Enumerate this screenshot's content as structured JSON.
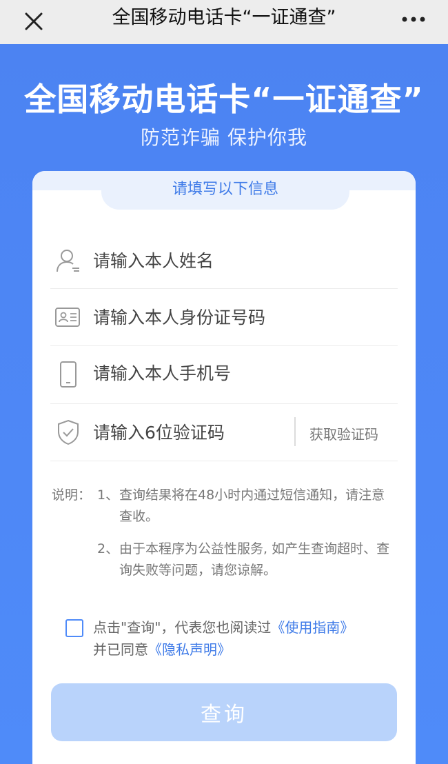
{
  "nav": {
    "title": "全国移动电话卡“一证通查”",
    "close_icon": "close-icon",
    "more_icon": "more-icon"
  },
  "hero": {
    "title": "全国移动电话卡“一证通查”",
    "subtitle": "防范诈骗 保护你我"
  },
  "form": {
    "tab_label": "请填写以下信息",
    "name_placeholder": "请输入本人姓名",
    "id_placeholder": "请输入本人身份证号码",
    "phone_placeholder": "请输入本人手机号",
    "code_placeholder": "请输入6位验证码",
    "get_code_label": "获取验证码"
  },
  "notes": {
    "label": "说明：",
    "items": [
      {
        "num": "1、",
        "text": "查询结果将在48小时内通过短信通知，请注意查收。"
      },
      {
        "num": "2、",
        "text": "由于本程序为公益性服务, 如产生查询超时、查询失败等问题，请您谅解。"
      }
    ]
  },
  "agreement": {
    "text_before": "点击\"查询\"，代表您也阅读过",
    "guide_link": "《使用指南》",
    "text_middle": "并已同意",
    "privacy_link": "《隐私声明》"
  },
  "submit": {
    "label": "查询"
  },
  "colors": {
    "brand": "#4f8bf9",
    "link": "#3f7be8",
    "button_disabled": "#b9d3fb"
  }
}
